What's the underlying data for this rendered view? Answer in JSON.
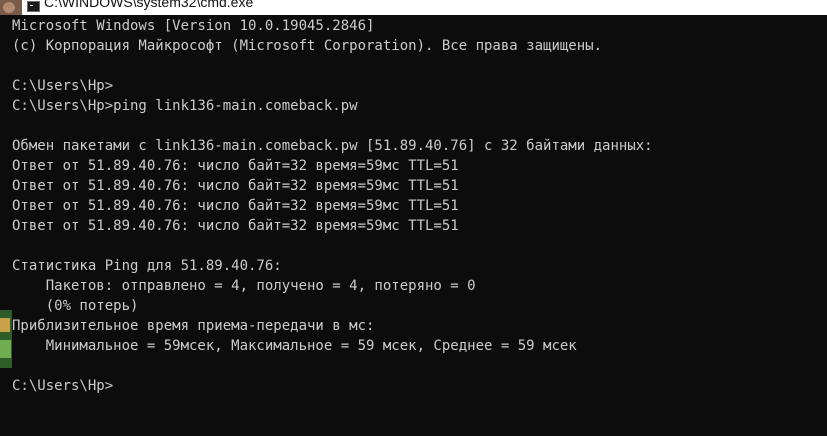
{
  "window": {
    "title": "C:\\WINDOWS\\system32\\cmd.exe"
  },
  "console": {
    "lines": [
      "Microsoft Windows [Version 10.0.19045.2846]",
      "(c) Корпорация Майкрософт (Microsoft Corporation). Все права защищены.",
      "",
      "C:\\Users\\Hp>",
      "C:\\Users\\Hp>ping link136-main.comeback.pw",
      "",
      "Обмен пакетами с link136-main.comeback.pw [51.89.40.76] с 32 байтами данных:",
      "Ответ от 51.89.40.76: число байт=32 время=59мс TTL=51",
      "Ответ от 51.89.40.76: число байт=32 время=59мс TTL=51",
      "Ответ от 51.89.40.76: число байт=32 время=59мс TTL=51",
      "Ответ от 51.89.40.76: число байт=32 время=59мс TTL=51",
      "",
      "Статистика Ping для 51.89.40.76:",
      "    Пакетов: отправлено = 4, получено = 4, потеряно = 0",
      "    (0% потерь)",
      "Приблизительное время приема-передачи в мс:",
      "    Минимальное = 59мсек, Максимальное = 59 мсек, Среднее = 59 мсек",
      "",
      "C:\\Users\\Hp>"
    ]
  },
  "colors": {
    "background": "#0c0c0c",
    "foreground": "#cccccc",
    "titlebar": "#ffffff"
  },
  "icons": {
    "window": "console-window-icon"
  }
}
